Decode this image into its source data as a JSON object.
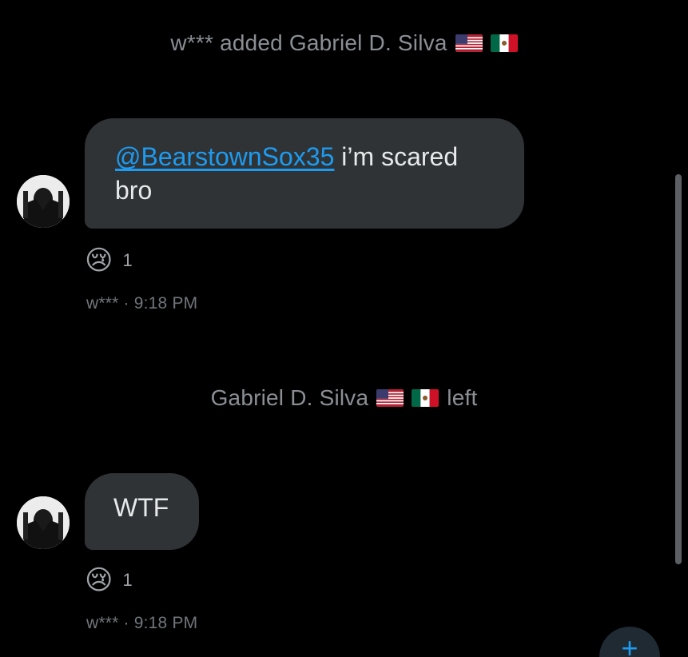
{
  "system_messages": [
    {
      "text": "w*** added Gabriel D. Silva",
      "flags": [
        "us-flag-icon",
        "mexico-flag-icon"
      ]
    },
    {
      "text_before": "Gabriel D. Silva",
      "text_after": "left",
      "flags": [
        "us-flag-icon",
        "mexico-flag-icon"
      ]
    }
  ],
  "messages": [
    {
      "mention": "@BearstownSox35",
      "text": " i’m scared bro",
      "reaction_emoji": "😢",
      "reaction_count": "1",
      "meta": "w*** · 9:18 PM"
    },
    {
      "text": "WTF",
      "reaction_emoji": "😢",
      "reaction_count": "1",
      "meta": "w*** · 9:18 PM"
    }
  ],
  "fab": {
    "icon": "new-message-icon",
    "label": "+"
  },
  "colors": {
    "background": "#000000",
    "bubble": "#2f3336",
    "mention": "#1d9bf0",
    "system_text": "#8b8f94",
    "meta_text": "#71767b"
  }
}
